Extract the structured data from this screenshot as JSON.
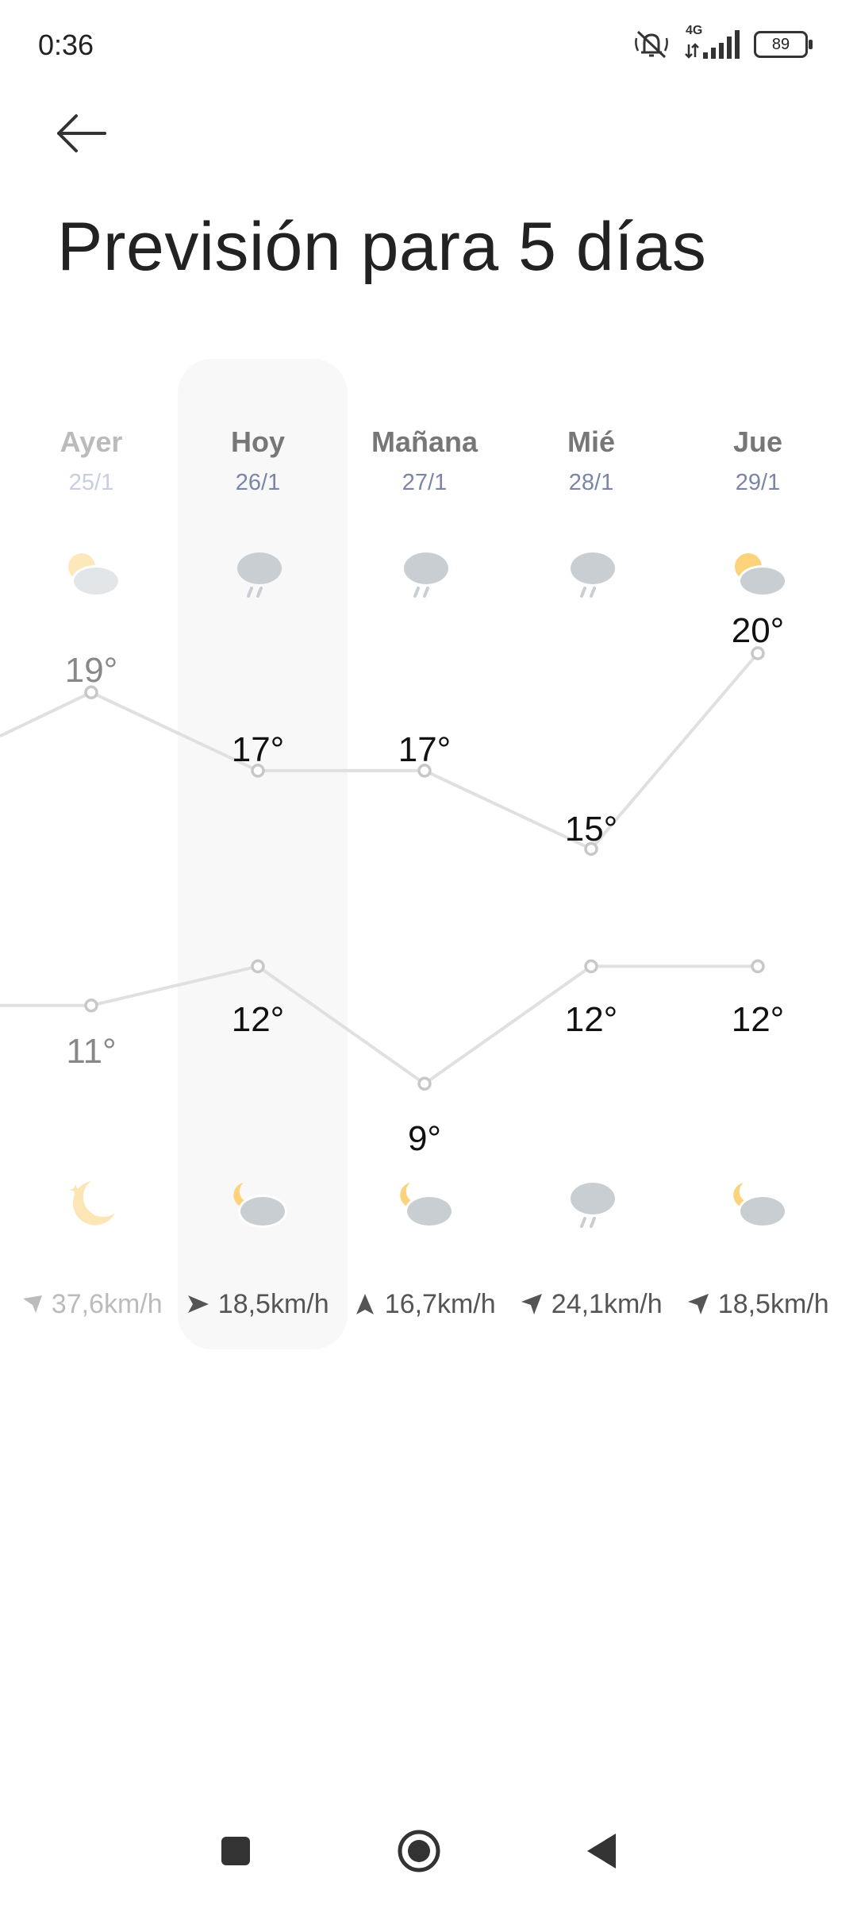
{
  "status_bar": {
    "time": "0:36",
    "network": "4G",
    "battery": "89",
    "icons": [
      "mute-icon",
      "signal-icon",
      "battery-icon"
    ]
  },
  "header": {
    "back_icon": "arrow-left-icon",
    "title": "Previsión para 5 días"
  },
  "days": [
    {
      "name": "Ayer",
      "date": "25/1",
      "day_icon": "partly-cloudy-icon",
      "high": "19°",
      "low": "11°",
      "night_icon": "moon-icon",
      "wind_icon": "arrow-icon",
      "wind": "37,6km/h"
    },
    {
      "name": "Hoy",
      "date": "26/1",
      "day_icon": "rain-icon",
      "high": "17°",
      "low": "12°",
      "night_icon": "cloudy-night-icon",
      "wind_icon": "arrow-icon",
      "wind": "18,5km/h"
    },
    {
      "name": "Mañana",
      "date": "27/1",
      "day_icon": "rain-icon",
      "high": "17°",
      "low": "9°",
      "night_icon": "cloudy-night-icon",
      "wind_icon": "arrow-icon",
      "wind": "16,7km/h"
    },
    {
      "name": "Mié",
      "date": "28/1",
      "day_icon": "rain-icon",
      "high": "15°",
      "low": "12°",
      "night_icon": "rain-icon",
      "wind_icon": "arrow-icon",
      "wind": "24,1km/h"
    },
    {
      "name": "Jue",
      "date": "29/1",
      "day_icon": "partly-cloudy-icon",
      "high": "20°",
      "low": "12°",
      "night_icon": "cloudy-night-icon",
      "wind_icon": "arrow-icon",
      "wind": "18,5km/h"
    }
  ],
  "chart_data": {
    "type": "line",
    "categories": [
      "25/1",
      "26/1",
      "27/1",
      "28/1",
      "29/1"
    ],
    "series": [
      {
        "values": [
          19,
          17,
          17,
          15,
          20
        ]
      },
      {
        "values": [
          11,
          12,
          9,
          12,
          12
        ]
      }
    ]
  },
  "colors": {
    "line": "#e0e0e0",
    "today_highlight": "#f8f8f8",
    "sun": "#fcd27b",
    "cloud": "#c9ced3",
    "date_text": "#7a85a8"
  },
  "nav_bar": {
    "icons": [
      "recents-square-icon",
      "home-circle-icon",
      "back-triangle-icon"
    ]
  }
}
